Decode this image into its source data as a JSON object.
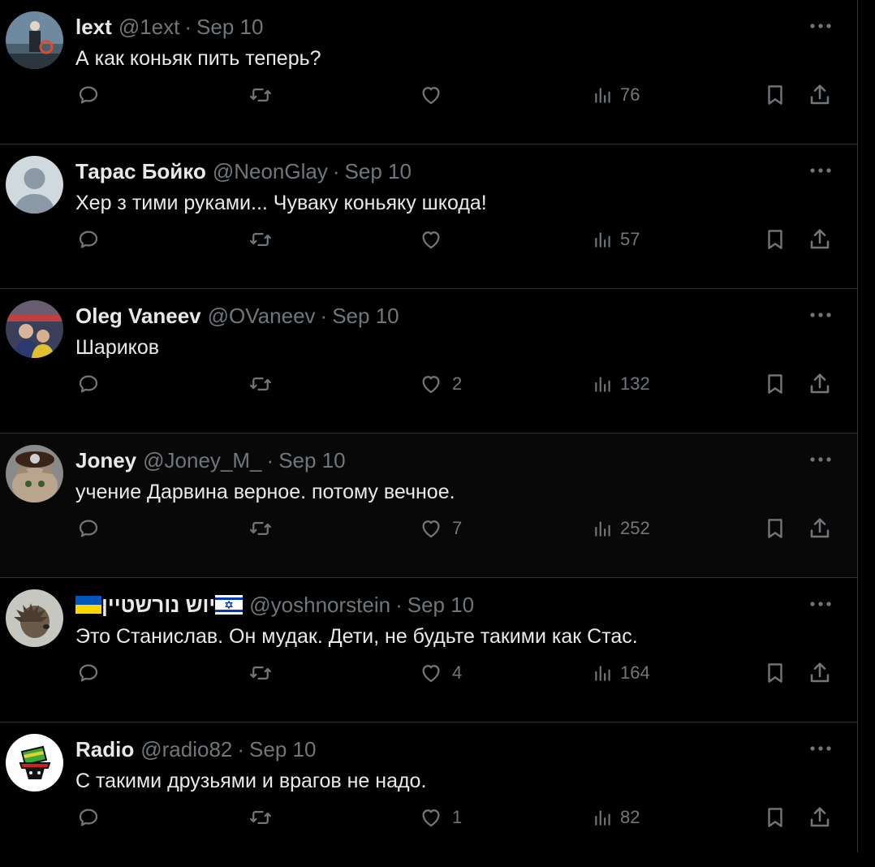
{
  "tweets": [
    {
      "name": "lext",
      "handle": "@1ext",
      "dot": "·",
      "date": "Sep 10",
      "text": "А как коньяк пить теперь?",
      "likes": "",
      "views": "76"
    },
    {
      "name": "Тарас Бойко",
      "handle": "@NeonGlay",
      "dot": "·",
      "date": "Sep 10",
      "text": "Хер з тими руками... Чуваку коньяку шкода!",
      "likes": "",
      "views": "57"
    },
    {
      "name": "Oleg Vaneev",
      "handle": "@OVaneev",
      "dot": "·",
      "date": "Sep 10",
      "text": "Шариков",
      "likes": "2",
      "views": "132"
    },
    {
      "name": "Joney",
      "handle": "@Joney_M_",
      "dot": "·",
      "date": "Sep 10",
      "text": "учение Дарвина верное. потому вечное.",
      "likes": "7",
      "views": "252"
    },
    {
      "name": "יוש נורשטיין",
      "handle": "@yoshnorstein",
      "dot": "·",
      "date": "Sep 10",
      "text": "Это Станислав. Он мудак. Дети, не будьте такими как Стас.",
      "likes": "4",
      "views": "164"
    },
    {
      "name": "Radio",
      "handle": "@radio82",
      "dot": "·",
      "date": "Sep 10",
      "text": "С такими друзьями и врагов не надо.",
      "likes": "1",
      "views": "82"
    }
  ],
  "icons": {
    "reply": "reply-icon",
    "retweet": "retweet-icon",
    "like": "heart-icon",
    "views": "analytics-icon",
    "bookmark": "bookmark-icon",
    "share": "share-icon",
    "more": "more-icon"
  },
  "colors": {
    "background": "#000000",
    "text": "#e7e9ea",
    "muted": "#71767b",
    "divider": "#2f3336"
  }
}
